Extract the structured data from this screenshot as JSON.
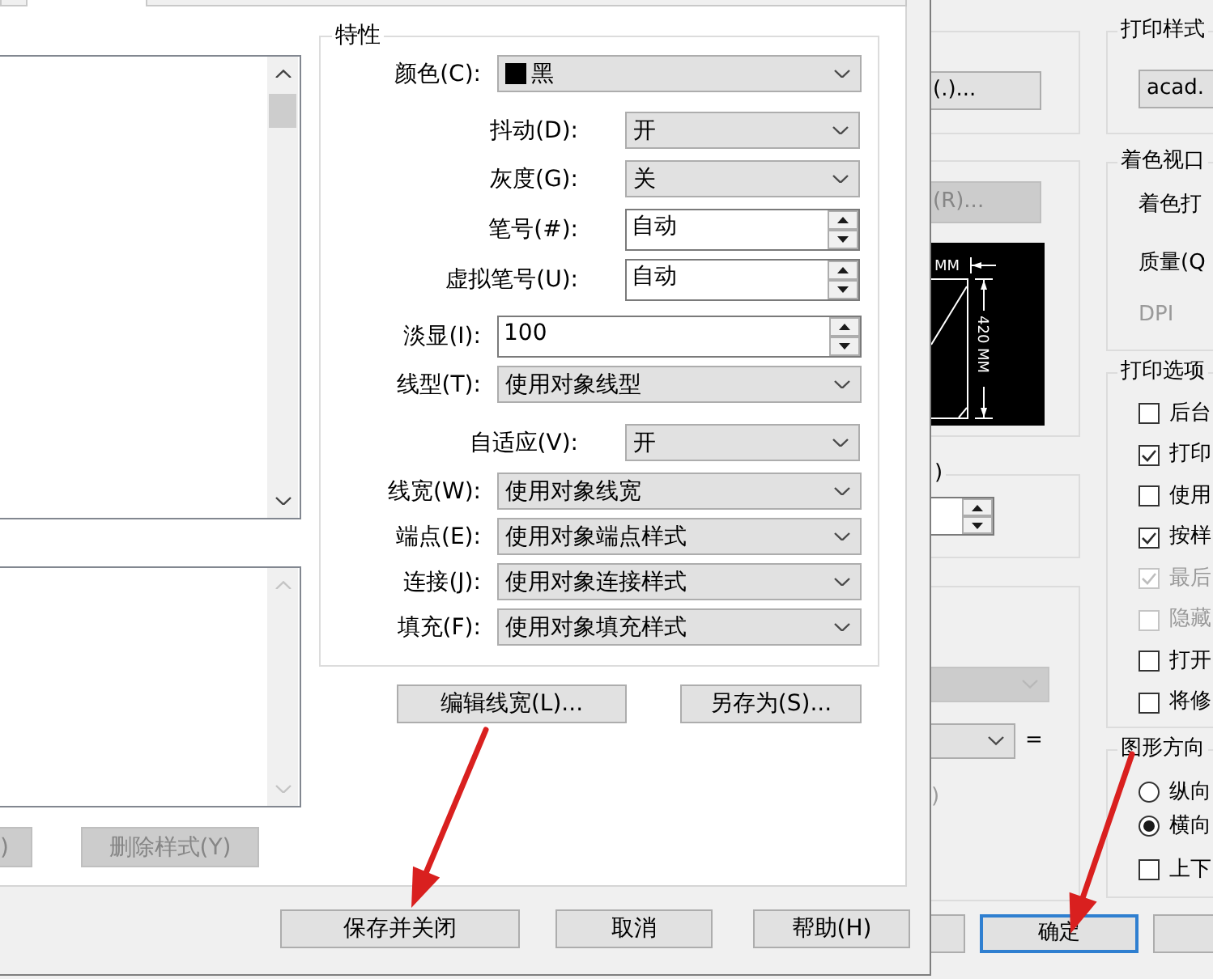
{
  "style_editor": {
    "tabs": [
      {
        "selected": false
      },
      {
        "selected": true
      },
      {
        "selected": false
      }
    ],
    "style_list": {
      "scrollbar_disabled": false
    },
    "description_box": {
      "scrollbar_disabled": true
    },
    "list_buttons": [
      {
        "label": ")",
        "disabled": true
      },
      {
        "label": "删除样式(Y)",
        "disabled": true
      }
    ],
    "properties": {
      "title": "特性",
      "fields": [
        {
          "label": "颜色(C):",
          "kind": "dropdown",
          "value": "黑",
          "color": "#000000"
        },
        {
          "label": "抖动(D):",
          "kind": "dropdown",
          "value": "开"
        },
        {
          "label": "灰度(G):",
          "kind": "dropdown",
          "value": "关"
        },
        {
          "label": "笔号(#):",
          "kind": "spinner",
          "value": "自动"
        },
        {
          "label": "虚拟笔号(U):",
          "kind": "spinner",
          "value": "自动"
        },
        {
          "label": "淡显(I):",
          "kind": "spinner",
          "value": "100"
        },
        {
          "label": "线型(T):",
          "kind": "dropdown",
          "value": "使用对象线型"
        },
        {
          "label": "自适应(V):",
          "kind": "dropdown",
          "value": "开"
        },
        {
          "label": "线宽(W):",
          "kind": "dropdown",
          "value": "使用对象线宽"
        },
        {
          "label": "端点(E):",
          "kind": "dropdown",
          "value": "使用对象端点样式"
        },
        {
          "label": "连接(J):",
          "kind": "dropdown",
          "value": "使用对象连接样式"
        },
        {
          "label": "填充(F):",
          "kind": "dropdown",
          "value": "使用对象填充样式"
        }
      ]
    },
    "property_buttons": [
      {
        "label": "编辑线宽(L)..."
      },
      {
        "label": "另存为(S)..."
      }
    ],
    "footer_buttons": [
      {
        "label": "保存并关闭"
      },
      {
        "label": "取消"
      },
      {
        "label": "帮助(H)"
      }
    ]
  },
  "plot_dialog": {
    "group_1": {
      "button": "(.)..."
    },
    "group_2": {
      "button": {
        "label": "(R)...",
        "disabled": true
      },
      "preview": {
        "width_label": "MM",
        "height_label": "420 MM"
      }
    },
    "group_3": {
      "title": ")"
    },
    "group_4": {
      "dropdowns": [
        {
          "disabled": true
        },
        {
          "disabled": false
        }
      ],
      "equals": "=",
      "label": {
        "text": ")",
        "disabled": true
      }
    },
    "plot_style_table": {
      "title": "打印样式",
      "value": "acad."
    },
    "shaded_viewport": {
      "title": "着色视口",
      "items": [
        {
          "text": "着色打",
          "disabled": false
        },
        {
          "text": "质量(Q",
          "disabled": false
        },
        {
          "text": "DPI",
          "disabled": true
        }
      ]
    },
    "plot_options": {
      "title": "打印选项",
      "options": [
        {
          "label": "后台",
          "checked": false,
          "disabled": false
        },
        {
          "label": "打印",
          "checked": true,
          "disabled": false
        },
        {
          "label": "使用",
          "checked": false,
          "disabled": false
        },
        {
          "label": "按样",
          "checked": true,
          "disabled": false
        },
        {
          "label": "最后",
          "checked": true,
          "disabled": true
        },
        {
          "label": "隐藏",
          "checked": false,
          "disabled": true
        },
        {
          "label": "打开",
          "checked": false,
          "disabled": false
        },
        {
          "label": "将修",
          "checked": false,
          "disabled": false
        }
      ]
    },
    "orientation": {
      "title": "图形方向",
      "options": [
        {
          "kind": "radio",
          "label": "纵向",
          "selected": false
        },
        {
          "kind": "radio",
          "label": "横向",
          "selected": true
        },
        {
          "kind": "checkbox",
          "label": "上下",
          "checked": false
        }
      ]
    },
    "buttons": [
      {
        "default": false
      },
      {
        "label": "确定",
        "default": true
      },
      {
        "default": false
      }
    ]
  },
  "annotations": [
    {
      "kind": "arrow"
    },
    {
      "kind": "arrow"
    }
  ]
}
